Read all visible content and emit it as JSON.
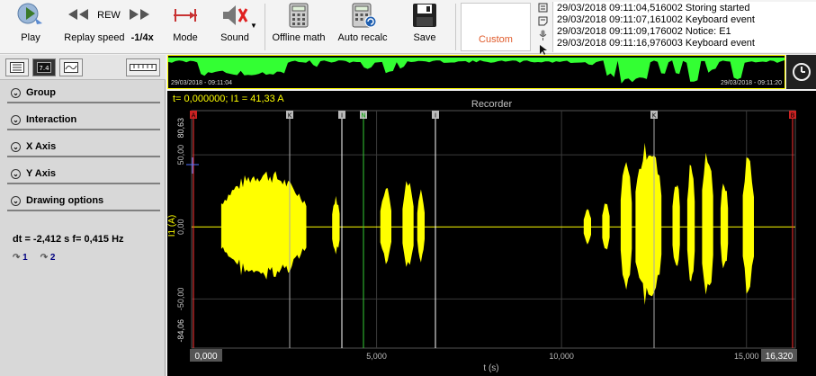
{
  "toolbar": {
    "play": "Play",
    "rew": "REW",
    "replay_speed": "Replay speed",
    "speed_value": "-1/4x",
    "mode": "Mode",
    "sound": "Sound",
    "offline_math": "Offline math",
    "auto_recalc": "Auto recalc",
    "save": "Save",
    "custom": "Custom"
  },
  "event_log": [
    "29/03/2018 09:11:04,516002 Storing started",
    "29/03/2018 09:11:07,161002 Keyboard event",
    "29/03/2018 09:11:09,176002 Notice: E1",
    "29/03/2018 09:11:16,976003 Keyboard event"
  ],
  "left_panel": {
    "sections": [
      "Group",
      "Interaction",
      "X Axis",
      "Y Axis",
      "Drawing options"
    ],
    "dt_line": "dt = -2,412 s  f= 0,415 Hz",
    "cursor1": "1",
    "cursor2": "2"
  },
  "overview": {
    "start_time": "29/03/2018 - 09:11:04",
    "end_time": "29/03/2018 - 09:11:20"
  },
  "recorder": {
    "status": "t= 0,000000; I1 = 41,33 A",
    "title": "Recorder",
    "ylabel": "I1 (A)",
    "xlabel": "t (s)",
    "ytop": "80,63",
    "ybottom": "-84,06",
    "xstart": "0,000",
    "xend": "16,320",
    "markers": [
      "A",
      "K",
      "I",
      "N",
      "I",
      "K",
      "B"
    ]
  },
  "colors": {
    "signal": "#ffff00",
    "overview_signal": "#33ff33",
    "marker_a": "#ff3333",
    "marker_n": "#33cc33",
    "custom_text": "#e05a2a"
  },
  "chart_data": {
    "type": "line",
    "title": "Recorder",
    "xlabel": "t (s)",
    "ylabel": "I1 (A)",
    "xlim": [
      0,
      16.32
    ],
    "ylim": [
      -84.06,
      80.63
    ],
    "xticks": [
      "0,000",
      "5,000",
      "10,000",
      "15,000",
      "16,320"
    ],
    "yticks": [
      "80,63",
      "50,00",
      "0,00",
      "-50,00",
      "-84,06"
    ],
    "grid": true,
    "series": [
      {
        "color": "#ffff00",
        "bursts": [
          {
            "x0": 0.8,
            "x1": 3.1,
            "amp": 41
          },
          {
            "x0": 3.8,
            "x1": 4.0,
            "amp": 22
          },
          {
            "x0": 5.1,
            "x1": 5.4,
            "amp": 30
          },
          {
            "x0": 5.7,
            "x1": 6.0,
            "amp": 36
          },
          {
            "x0": 6.1,
            "x1": 6.3,
            "amp": 28
          },
          {
            "x0": 10.6,
            "x1": 10.8,
            "amp": 14
          },
          {
            "x0": 11.1,
            "x1": 11.3,
            "amp": 18
          },
          {
            "x0": 11.6,
            "x1": 11.9,
            "amp": 48
          },
          {
            "x0": 12.0,
            "x1": 12.7,
            "amp": 62
          },
          {
            "x0": 13.0,
            "x1": 13.2,
            "amp": 36
          },
          {
            "x0": 13.4,
            "x1": 13.6,
            "amp": 48
          },
          {
            "x0": 13.8,
            "x1": 14.1,
            "amp": 58
          },
          {
            "x0": 14.3,
            "x1": 14.5,
            "amp": 34
          },
          {
            "x0": 14.9,
            "x1": 15.2,
            "amp": 54
          }
        ]
      }
    ]
  }
}
